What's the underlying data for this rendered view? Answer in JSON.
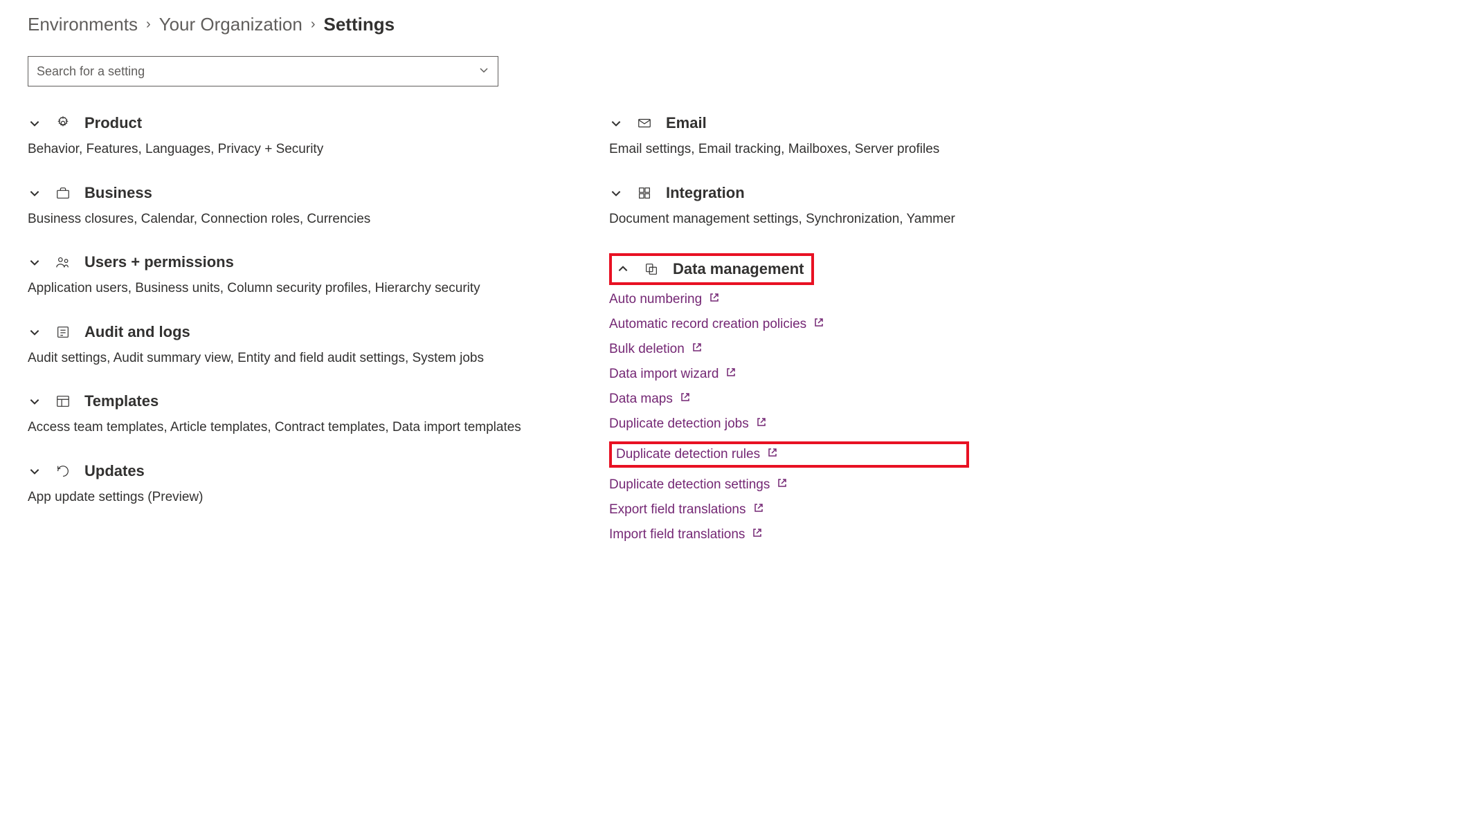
{
  "breadcrumb": {
    "level1": "Environments",
    "level2": "Your Organization",
    "current": "Settings"
  },
  "search": {
    "placeholder": "Search for a setting"
  },
  "left_sections": [
    {
      "key": "product",
      "title": "Product",
      "desc": "Behavior, Features, Languages, Privacy + Security",
      "icon": "gear"
    },
    {
      "key": "business",
      "title": "Business",
      "desc": "Business closures, Calendar, Connection roles, Currencies",
      "icon": "briefcase"
    },
    {
      "key": "users",
      "title": "Users + permissions",
      "desc": "Application users, Business units, Column security profiles, Hierarchy security",
      "icon": "people"
    },
    {
      "key": "audit",
      "title": "Audit and logs",
      "desc": "Audit settings, Audit summary view, Entity and field audit settings, System jobs",
      "icon": "list"
    },
    {
      "key": "templates",
      "title": "Templates",
      "desc": "Access team templates, Article templates, Contract templates, Data import templates",
      "icon": "templates"
    },
    {
      "key": "updates",
      "title": "Updates",
      "desc": "App update settings (Preview)",
      "icon": "refresh"
    }
  ],
  "right_sections": {
    "email": {
      "title": "Email",
      "desc": "Email settings, Email tracking, Mailboxes, Server profiles"
    },
    "integration": {
      "title": "Integration",
      "desc": "Document management settings, Synchronization, Yammer"
    },
    "data_management": {
      "title": "Data management",
      "links": [
        "Auto numbering",
        "Automatic record creation policies",
        "Bulk deletion",
        "Data import wizard",
        "Data maps",
        "Duplicate detection jobs",
        "Duplicate detection rules",
        "Duplicate detection settings",
        "Export field translations",
        "Import field translations"
      ]
    }
  }
}
